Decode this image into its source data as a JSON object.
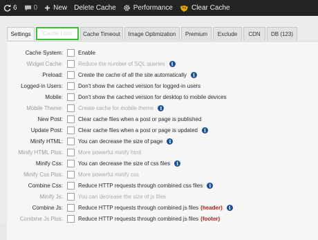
{
  "adminbar": {
    "updates_count": "6",
    "comments_count": "0",
    "new_label": "New",
    "delete_cache_label": "Delete Cache",
    "performance_label": "Performance",
    "clear_cache_label": "Clear Cache"
  },
  "tabs": [
    {
      "label": "Settings"
    },
    {
      "label": "Cache Lists"
    },
    {
      "label": "Cache Timeout"
    },
    {
      "label": "Image Optimization"
    },
    {
      "label": "Premium"
    },
    {
      "label": "Exclude"
    },
    {
      "label": "CDN"
    },
    {
      "label": "DB (123)"
    }
  ],
  "options": [
    {
      "label": "Cache System:",
      "desc": "Enable",
      "info": false
    },
    {
      "label": "Widget Cache:",
      "desc": "Reduce the number of SQL queries",
      "info": true
    },
    {
      "label": "Preload:",
      "desc": "Create the cache of all the site automatically",
      "info": true
    },
    {
      "label": "Logged-in Users:",
      "desc": "Don't show the cached version for logged-in users",
      "info": false
    },
    {
      "label": "Mobile:",
      "desc": "Don't show the cached version for desktop to mobile devices",
      "info": false
    },
    {
      "label": "Mobile Theme:",
      "desc": "Create cache for mobile theme",
      "info": true
    },
    {
      "label": "New Post:",
      "desc": "Clear cache files when a post or page is published",
      "info": false
    },
    {
      "label": "Update Post:",
      "desc": "Clear cache files when a post or page is updated",
      "info": true
    },
    {
      "label": "Minify HTML:",
      "desc": "You can decrease the size of page",
      "info": true
    },
    {
      "label": "Minify HTML Plus:",
      "desc": "More powerful minify html",
      "info": false
    },
    {
      "label": "Minify Css:",
      "desc": "You can decrease the size of css files",
      "info": true
    },
    {
      "label": "Minify Css Plus:",
      "desc": "More powerful minify css",
      "info": false
    },
    {
      "label": "Combine Css:",
      "desc": "Reduce HTTP requests through combined css files",
      "info": true
    },
    {
      "label": "Minify Js:",
      "desc": "You can decrease the size of js files",
      "info": false
    },
    {
      "label": "Combine Js:",
      "desc": "Reduce HTTP requests through combined js files",
      "tag": "(header)",
      "info": true
    },
    {
      "label": "Combine Js Plus:",
      "desc": "Reduce HTTP requests through combined js files",
      "tag": "(footer)",
      "info": false
    }
  ],
  "info_glyph": "i",
  "colors": {
    "adminbar_bg": "#232323",
    "info_blue": "#1a4f9e",
    "tag_red": "#b11e1e",
    "highlight_green": "#3dbb3d"
  }
}
